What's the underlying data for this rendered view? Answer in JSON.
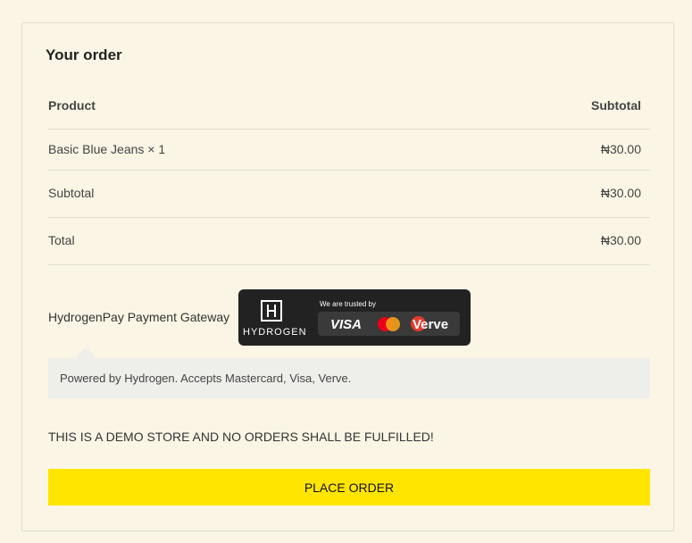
{
  "order": {
    "title": "Your order",
    "header": {
      "product": "Product",
      "subtotal": "Subtotal"
    },
    "items": [
      {
        "name": "Basic Blue Jeans × 1",
        "price": "₦30.00"
      }
    ],
    "subtotal": {
      "label": "Subtotal",
      "value": "₦30.00"
    },
    "total": {
      "label": "Total",
      "value": "₦30.00"
    }
  },
  "payment": {
    "gateway_label": "HydrogenPay Payment Gateway",
    "badge": {
      "brand": "HYDROGEN",
      "trusted_text": "We are trusted by",
      "cards": [
        "VISA",
        "Mastercard",
        "Verve"
      ],
      "visa_text": "VISA",
      "verve_text": "Verve"
    },
    "description": "Powered by Hydrogen. Accepts Mastercard, Visa, Verve."
  },
  "notice": "THIS IS A DEMO STORE AND NO ORDERS SHALL BE FULFILLED!",
  "actions": {
    "place_order": "PLACE ORDER"
  },
  "colors": {
    "background": "#faf5e4",
    "button": "#ffe500",
    "description_bg": "#eeeeea"
  }
}
